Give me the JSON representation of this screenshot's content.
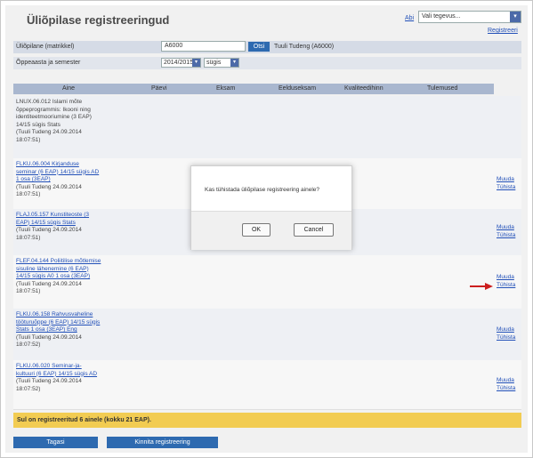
{
  "header": {
    "title": "Üliõpilase registreeringud",
    "lang_link": "Abi",
    "role_select": "Vali tegevus...",
    "help_link": "Registreeri"
  },
  "form": {
    "student_label": "Üliõpilane (matrikkel)",
    "student_code": "A6000",
    "search_button": "Otsi",
    "student_name": "Tuuli Tudeng (A6000)",
    "year_label": "Õppeaasta ja semester",
    "year_value": "2014/2015",
    "semester_value": "sügis"
  },
  "table": {
    "columns": [
      "Aine",
      "Päevi",
      "Eksam",
      "Eelduseksam",
      "Kvaliteedihinn",
      "Tulemused"
    ],
    "rows": [
      {
        "lines": [
          "LNUX.06.012 Islami mõte",
          "õppeprogrammis: Ikooni ning",
          "identiteetmooriumine (3 EAP)",
          "14/15 sügis Stats",
          "(Tuuli Tudeng 24.09.2014",
          "18:07:51)"
        ],
        "link": false,
        "actions": []
      },
      {
        "lines": [
          "FLKU.06.004 Kirjanduse",
          "seminar (6 EAP) 14/15 sügis AD",
          "1 osa (3EAP)",
          "(Tuuli Tudeng 24.09.2014",
          "18:07:51)"
        ],
        "link": true,
        "actions": [
          "Muuda",
          "Tühista"
        ]
      },
      {
        "lines": [
          "FLAJ.05.157 Kunstiteoste (3",
          "EAP) 14/15 sügis Stats",
          "(Tuuli Tudeng 24.09.2014",
          "18:07:51)"
        ],
        "link": true,
        "actions": [
          "Muuda",
          "Tühista"
        ]
      },
      {
        "lines": [
          "FLEF.04.144 Poliitilise mõtlemise",
          "sisuline lähenemine (6 EAP)",
          "14/15 sügis A0 1 osa (3EAP)",
          "(Tuuli Tudeng 24.09.2014",
          "18:07:51)"
        ],
        "link": true,
        "actions": [
          "Muuda",
          "Tühista"
        ]
      },
      {
        "lines": [
          "FLKU.06.158 Rahvusvaheline",
          "tööturuõppe (6 EAP) 14/15 sügis",
          "Stats 1 osa (3EAP) Eng",
          "(Tuuli Tudeng 24.09.2014",
          "18:07:52)"
        ],
        "link": true,
        "actions": [
          "Muuda",
          "Tühista"
        ]
      },
      {
        "lines": [
          "FLKU.06.020 Seminar-ja-",
          "kultuuri (6 EAP) 14/15 sügis AD",
          "(Tuuli Tudeng 24.09.2014",
          "18:07:52)"
        ],
        "link": true,
        "actions": [
          "Muuda",
          "Tühista"
        ]
      }
    ]
  },
  "footer": {
    "summary": "Sul on registreeritud 6 ainele (kokku 21 EAP).",
    "save_button": "Tagasi",
    "confirm_button": "Kinnita registreering"
  },
  "dialog": {
    "message": "Kas tühistada üliõpilase registreering ainele?",
    "ok_label": "OK",
    "cancel_label": "Cancel"
  },
  "colors": {
    "accent": "#2e6ab0",
    "summary_bar": "#f2cc52",
    "header_row": "#a9b7cf",
    "arrow": "#cc1f1f"
  }
}
